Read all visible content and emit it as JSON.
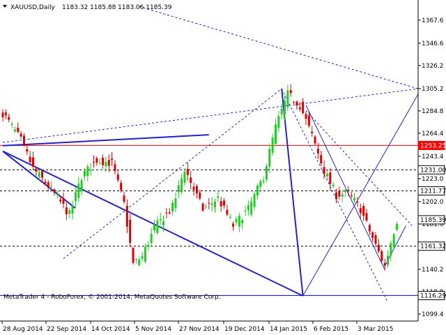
{
  "header": {
    "symbol": "XAUUSD,Daily",
    "ohlc": "1183.32 1185.88 1183.06 1185.39"
  },
  "footer": {
    "copyright": "MetaTrader 4 - RoboForex, © 2001-2014, MetaQuotes Software Corp."
  },
  "chart_data": {
    "type": "candlestick",
    "title": "XAUUSD,Daily",
    "ylim": [
      1093,
      1386
    ],
    "grid": false,
    "x_ticks": [
      "28 Aug 2014",
      "22 Sep 2014",
      "14 Oct 2014",
      "5 Nov 2014",
      "27 Nov 2014",
      "19 Dec 2014",
      "14 Jan 2015",
      "6 Feb 2015",
      "3 Mar 2015"
    ],
    "y_ticks": [
      1367.6,
      1346.6,
      1326.2,
      1305.2,
      1284.8,
      1264.4,
      1243.4,
      1223.0,
      1202.0,
      1181.6,
      1160.6,
      1140.2,
      1119.8,
      1099.4
    ],
    "price_levels": [
      {
        "label": "1253.25",
        "value": 1253.25,
        "color": "#ff0000",
        "style": "solid"
      },
      {
        "label": "1231.00",
        "value": 1231.0,
        "color": "#000000",
        "style": "dashed"
      },
      {
        "label": "1211.77",
        "value": 1211.77,
        "color": "#000000",
        "style": "dashed"
      },
      {
        "label": "1185.39",
        "value": 1185.39,
        "color": "#000000",
        "style": "current"
      },
      {
        "label": "1161.32",
        "value": 1161.32,
        "color": "#000000",
        "style": "dashed"
      },
      {
        "label": "1116.29",
        "value": 1116.29,
        "color": "#0000cc",
        "style": "solid"
      }
    ],
    "colors": {
      "bull": "#22cc22",
      "bear": "#dd0000",
      "trend": "#2222cc",
      "channel": "#2222cc"
    },
    "anchors": [
      {
        "i": 0,
        "c": 1283
      },
      {
        "i": 6,
        "c": 1258
      },
      {
        "i": 10,
        "c": 1232
      },
      {
        "i": 16,
        "c": 1213
      },
      {
        "i": 22,
        "c": 1190
      },
      {
        "i": 26,
        "c": 1225
      },
      {
        "i": 31,
        "c": 1240
      },
      {
        "i": 36,
        "c": 1237
      },
      {
        "i": 40,
        "c": 1200
      },
      {
        "i": 43,
        "c": 1145
      },
      {
        "i": 46,
        "c": 1152
      },
      {
        "i": 50,
        "c": 1178
      },
      {
        "i": 56,
        "c": 1197
      },
      {
        "i": 60,
        "c": 1232
      },
      {
        "i": 66,
        "c": 1195
      },
      {
        "i": 71,
        "c": 1205
      },
      {
        "i": 76,
        "c": 1180
      },
      {
        "i": 81,
        "c": 1195
      },
      {
        "i": 86,
        "c": 1225
      },
      {
        "i": 90,
        "c": 1270
      },
      {
        "i": 94,
        "c": 1300
      },
      {
        "i": 98,
        "c": 1290
      },
      {
        "i": 102,
        "c": 1262
      },
      {
        "i": 106,
        "c": 1230
      },
      {
        "i": 110,
        "c": 1208
      },
      {
        "i": 114,
        "c": 1210
      },
      {
        "i": 118,
        "c": 1195
      },
      {
        "i": 123,
        "c": 1162
      },
      {
        "i": 126,
        "c": 1143
      },
      {
        "i": 128,
        "c": 1165
      },
      {
        "i": 130,
        "c": 1185
      }
    ],
    "candle_count": 131
  }
}
